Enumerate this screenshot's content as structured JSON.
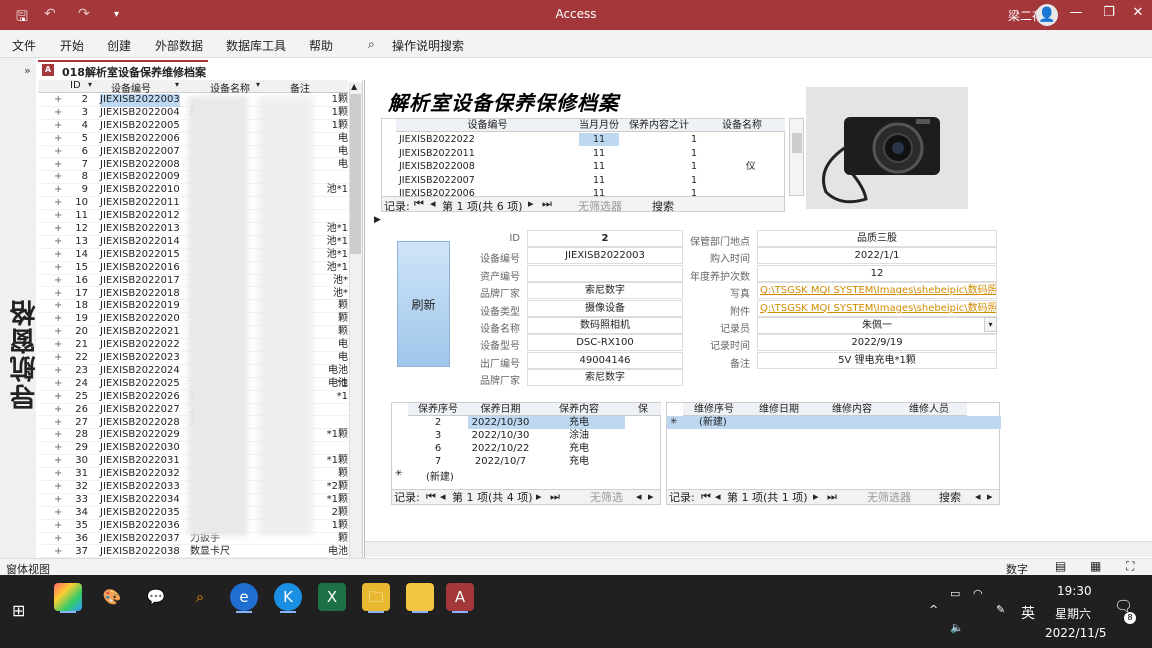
{
  "app": {
    "title": "Access",
    "user": "梁二存"
  },
  "menu": [
    "文件",
    "开始",
    "创建",
    "外部数据",
    "数据库工具",
    "帮助"
  ],
  "search": {
    "label": "操作说明搜索"
  },
  "nav": {
    "title": "导航窗格"
  },
  "doc_tab": {
    "label": "018解析室设备保养维修档案"
  },
  "sheet": {
    "headers": [
      "ID",
      "设备编号",
      "设备名称",
      "备注"
    ],
    "rows": [
      {
        "id": "2",
        "code": "JIEXISB2022003",
        "name": "",
        "note": "1颗"
      },
      {
        "id": "3",
        "code": "JIEXISB2022004",
        "name": "数",
        "note": "1颗"
      },
      {
        "id": "4",
        "code": "JIEXISB2022005",
        "name": "",
        "note": "1颗"
      },
      {
        "id": "5",
        "code": "JIEXISB2022006",
        "name": "",
        "note": "电"
      },
      {
        "id": "6",
        "code": "JIEXISB2022007",
        "name": "",
        "note": "电"
      },
      {
        "id": "7",
        "code": "JIEXISB2022008",
        "name": "手",
        "note": "电"
      },
      {
        "id": "8",
        "code": "JIEXISB2022009",
        "name": "",
        "note": ""
      },
      {
        "id": "9",
        "code": "JIEXISB2022010",
        "name": "",
        "note": "池*1"
      },
      {
        "id": "10",
        "code": "JIEXISB2022011",
        "name": "",
        "note": ""
      },
      {
        "id": "11",
        "code": "JIEXISB2022012",
        "name": "",
        "note": ""
      },
      {
        "id": "12",
        "code": "JIEXISB2022013",
        "name": "",
        "note": "池*1"
      },
      {
        "id": "13",
        "code": "JIEXISB2022014",
        "name": "",
        "note": "池*1"
      },
      {
        "id": "14",
        "code": "JIEXISB2022015",
        "name": "",
        "note": "池*1"
      },
      {
        "id": "15",
        "code": "JIEXISB2022016",
        "name": "",
        "note": "池*1"
      },
      {
        "id": "16",
        "code": "JIEXISB2022017",
        "name": "",
        "note": "池*"
      },
      {
        "id": "17",
        "code": "JIEXISB2022018",
        "name": "",
        "note": "池*"
      },
      {
        "id": "18",
        "code": "JIEXISB2022019",
        "name": "多",
        "note": "颗"
      },
      {
        "id": "19",
        "code": "JIEXISB2022020",
        "name": "多",
        "note": "颗"
      },
      {
        "id": "20",
        "code": "JIEXISB2022021",
        "name": "多",
        "note": "颗"
      },
      {
        "id": "21",
        "code": "JIEXISB2022022",
        "name": "",
        "note": "电"
      },
      {
        "id": "22",
        "code": "JIEXISB2022023",
        "name": "",
        "note": "电"
      },
      {
        "id": "23",
        "code": "JIEXISB2022024",
        "name": "",
        "note": "电池*1"
      },
      {
        "id": "24",
        "code": "JIEXISB2022025",
        "name": "大量",
        "note": "电池*1"
      },
      {
        "id": "25",
        "code": "JIEXISB2022026",
        "name": "直",
        "note": ""
      },
      {
        "id": "26",
        "code": "JIEXISB2022027",
        "name": "直",
        "note": ""
      },
      {
        "id": "27",
        "code": "JIEXISB2022028",
        "name": "直",
        "note": ""
      },
      {
        "id": "28",
        "code": "JIEXISB2022029",
        "name": "",
        "note": "*1颗"
      },
      {
        "id": "29",
        "code": "JIEXISB2022030",
        "name": "",
        "note": ""
      },
      {
        "id": "30",
        "code": "JIEXISB2022031",
        "name": "",
        "note": "*1颗"
      },
      {
        "id": "31",
        "code": "JIEXISB2022032",
        "name": "",
        "note": "颗"
      },
      {
        "id": "32",
        "code": "JIEXISB2022033",
        "name": "",
        "note": "*2颗"
      },
      {
        "id": "33",
        "code": "JIEXISB2022034",
        "name": "",
        "note": "*1颗"
      },
      {
        "id": "34",
        "code": "JIEXISB2022035",
        "name": "",
        "note": "2颗"
      },
      {
        "id": "35",
        "code": "JIEXISB2022036",
        "name": "",
        "note": "1颗"
      },
      {
        "id": "36",
        "code": "JIEXISB2022037",
        "name": "力扳手",
        "note": "颗"
      },
      {
        "id": "37",
        "code": "JIEXISB2022038",
        "name": "数显卡尺",
        "note": "电池"
      }
    ]
  },
  "form": {
    "title": "解析室设备保养保修档案",
    "summary": {
      "headers": [
        "设备编号",
        "当月月份",
        "保养内容之计",
        "设备名称"
      ],
      "rows": [
        {
          "code": "JIEXISB2022022",
          "month": "11",
          "count": "1",
          "name": ""
        },
        {
          "code": "JIEXISB2022011",
          "month": "11",
          "count": "1",
          "name": ""
        },
        {
          "code": "JIEXISB2022008",
          "month": "11",
          "count": "1",
          "name": "仪"
        },
        {
          "code": "JIEXISB2022007",
          "month": "11",
          "count": "1",
          "name": ""
        },
        {
          "code": "JIEXISB2022006",
          "month": "11",
          "count": "1",
          "name": ""
        }
      ],
      "rec_label": "记录:",
      "rec_pos": "第 1 项(共 6 项)",
      "filter": "无筛选器",
      "search": "搜索"
    },
    "refresh": "刷新",
    "fields_left": [
      {
        "label": "ID",
        "value": "2"
      },
      {
        "label": "设备编号",
        "value": "JIEXISB2022003"
      },
      {
        "label": "资产编号",
        "value": ""
      },
      {
        "label": "品牌厂家",
        "value": "索尼数字"
      },
      {
        "label": "设备类型",
        "value": "摄像设备"
      },
      {
        "label": "设备名称",
        "value": "数码照相机"
      },
      {
        "label": "设备型号",
        "value": "DSC-RX100"
      },
      {
        "label": "出厂编号",
        "value": "49004146"
      },
      {
        "label": "品牌厂家",
        "value": "索尼数字"
      }
    ],
    "fields_right": [
      {
        "label": "保管部门地点",
        "value": "品质三股"
      },
      {
        "label": "购入时间",
        "value": "2022/1/1"
      },
      {
        "label": "年度养护次数",
        "value": "12"
      },
      {
        "label": "写真",
        "value": "Q:\\TSGSK MQI SYSTEM\\Images\\shebeipic\\数码照相机\\"
      },
      {
        "label": "附件",
        "value": "Q:\\TSGSK MQI SYSTEM\\Images\\shebeipic\\数码照相机\\"
      },
      {
        "label": "记录员",
        "value": "朱佩一"
      },
      {
        "label": "记录时间",
        "value": "2022/9/19"
      },
      {
        "label": "备注",
        "value": "5V 锂电充电*1颗"
      }
    ],
    "maintenance": {
      "headers": [
        "保养序号",
        "保养日期",
        "保养内容",
        "保"
      ],
      "rows": [
        {
          "no": "2",
          "date": "2022/10/30",
          "content": "充电"
        },
        {
          "no": "3",
          "date": "2022/10/30",
          "content": "涂油"
        },
        {
          "no": "6",
          "date": "2022/10/22",
          "content": "充电"
        },
        {
          "no": "7",
          "date": "2022/10/7",
          "content": "充电"
        }
      ],
      "new_row": "(新建)",
      "rec_label": "记录:",
      "rec_pos": "第 1 项(共 4 项)",
      "filter": "无筛选"
    },
    "repair": {
      "headers": [
        "维修序号",
        "维修日期",
        "维修内容",
        "维修人员"
      ],
      "new_row": "(新建)",
      "rec_label": "记录:",
      "rec_pos": "第 1 项(共 1 项)",
      "filter": "无筛选器",
      "search": "搜索"
    }
  },
  "status": {
    "left": "窗体视图",
    "right": "数字"
  },
  "taskbar": {
    "time": "19:30",
    "weekday": "星期六",
    "date": "2022/11/5",
    "ime": "英",
    "notif_count": "8"
  },
  "colors": {
    "accent": "#a4373a",
    "selection": "#bfd8f2",
    "link": "#d28b00"
  }
}
